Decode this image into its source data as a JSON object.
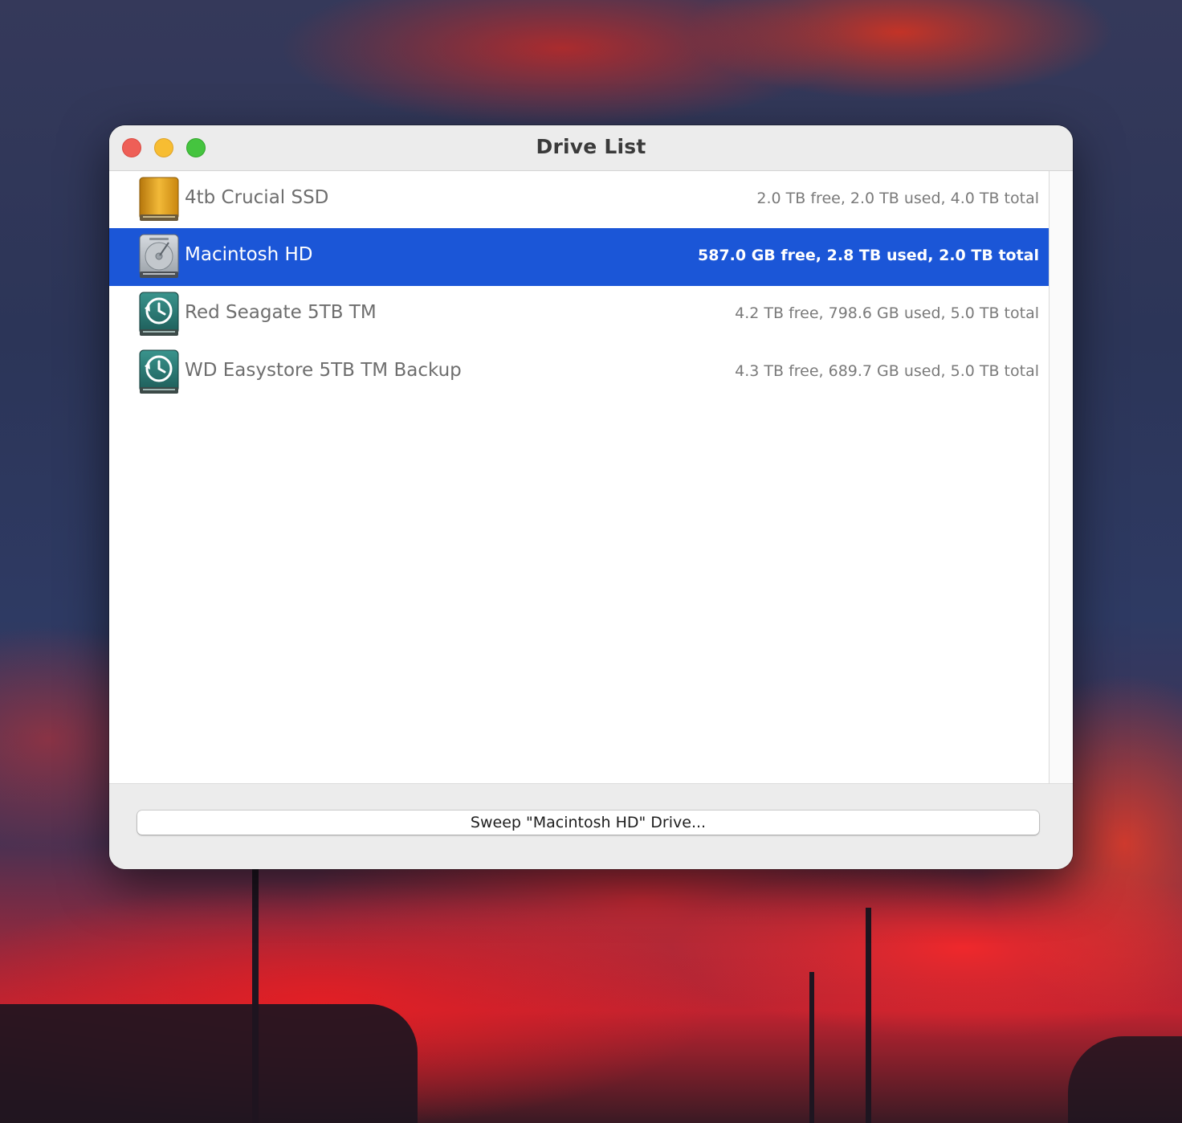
{
  "window": {
    "title": "Drive List",
    "controls": [
      "close",
      "minimize",
      "zoom"
    ]
  },
  "drives": [
    {
      "name": "4tb Crucial SSD",
      "stats": "2.0 TB free, 2.0 TB used, 4.0 TB total",
      "icon": "external-drive-icon",
      "selected": false
    },
    {
      "name": "Macintosh HD",
      "stats": "587.0 GB free, 2.8 TB used, 2.0 TB total",
      "icon": "internal-hard-drive-icon",
      "selected": true
    },
    {
      "name": "Red Seagate 5TB TM",
      "stats": "4.2 TB free, 798.6 GB used, 5.0 TB total",
      "icon": "time-machine-drive-icon",
      "selected": false
    },
    {
      "name": "WD Easystore 5TB TM Backup",
      "stats": "4.3 TB free, 689.7 GB used, 5.0 TB total",
      "icon": "time-machine-drive-icon",
      "selected": false
    }
  ],
  "footer": {
    "sweep_button_label": "Sweep \"Macintosh HD\" Drive..."
  },
  "colors": {
    "selection": "#1b56d7",
    "close": "#ee5f57",
    "minimize": "#f7bd32",
    "zoom": "#45c43f",
    "external_drive": "#e0a020",
    "time_machine_drive": "#2e7f7a"
  }
}
